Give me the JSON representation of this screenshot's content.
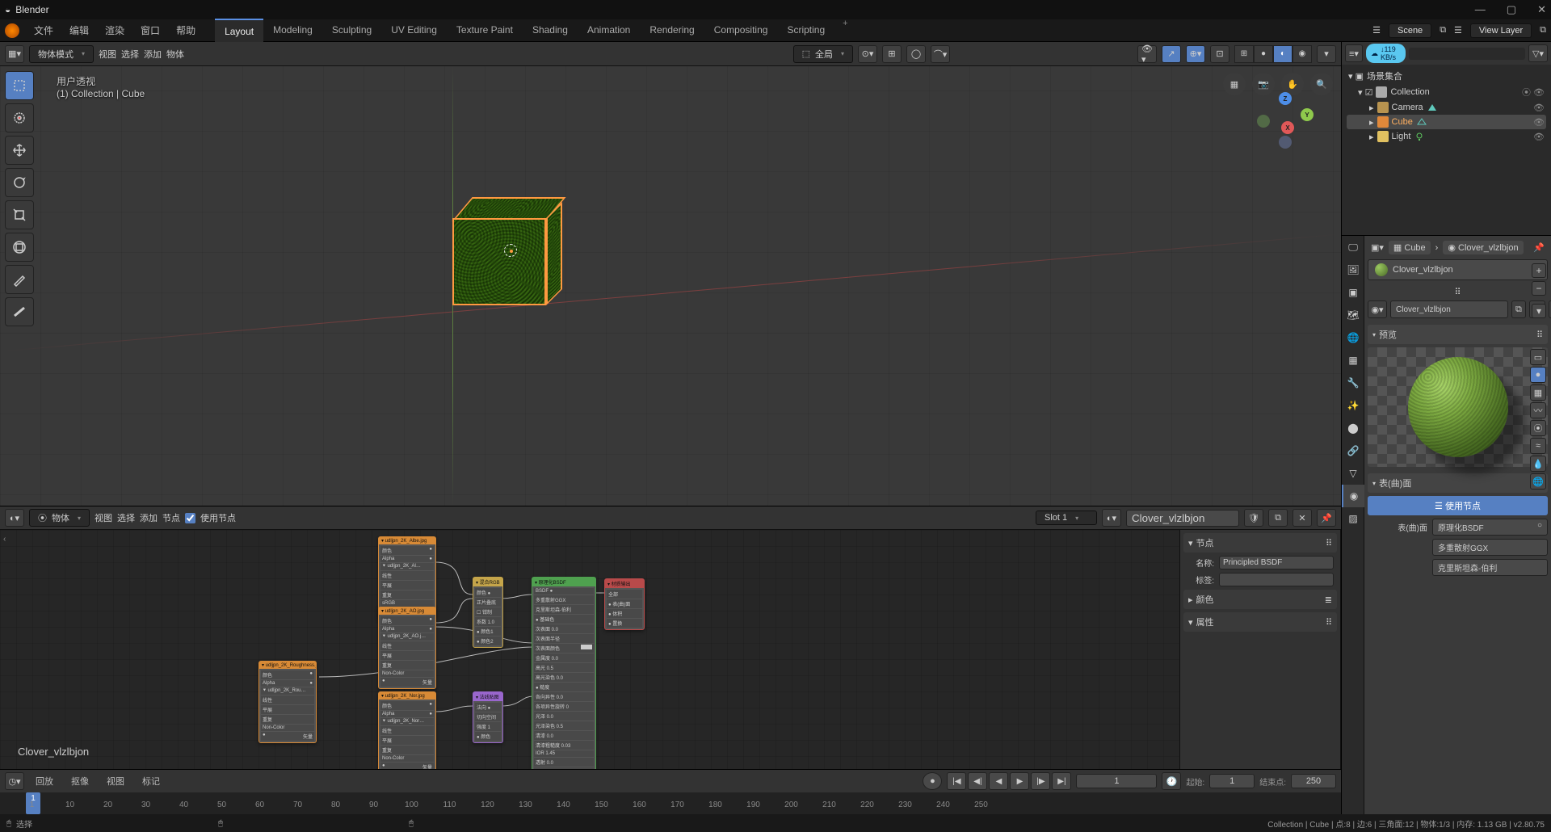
{
  "app": {
    "name": "Blender"
  },
  "topmenu": [
    "文件",
    "编辑",
    "渲染",
    "窗口",
    "帮助"
  ],
  "workspaces": [
    "Layout",
    "Modeling",
    "Sculpting",
    "UV Editing",
    "Texture Paint",
    "Shading",
    "Animation",
    "Rendering",
    "Compositing",
    "Scripting"
  ],
  "active_workspace": "Layout",
  "scene": {
    "label": "Scene",
    "viewlayer": "View Layer"
  },
  "download_badge": "↓119 KB/s",
  "viewport": {
    "mode": "物体模式",
    "menus": [
      "视图",
      "选择",
      "添加",
      "物体"
    ],
    "snapping": "全局",
    "info_line1": "用户透视",
    "info_line2": "(1) Collection | Cube",
    "gizmo": {
      "x": "X",
      "y": "Y",
      "z": "Z"
    }
  },
  "outliner": {
    "root": "场景集合",
    "collection": "Collection",
    "items": [
      {
        "name": "Camera"
      },
      {
        "name": "Cube"
      },
      {
        "name": "Light"
      }
    ],
    "filter_placeholder": ""
  },
  "node_editor": {
    "mode_label": "物体",
    "menus": [
      "视图",
      "选择",
      "添加",
      "节点"
    ],
    "use_nodes": "使用节点",
    "slot": "Slot 1",
    "material": "Clover_vlzlbjon",
    "bottom_label": "Clover_vlzlbjon",
    "side": {
      "hdr_node": "节点",
      "hdr_props": "属性",
      "hdr_color": "颜色",
      "name_label": "名称:",
      "name_value": "Principled BSDF",
      "tag_label": "标签:"
    }
  },
  "properties": {
    "object": "Cube",
    "material": "Clover_vlzlbjon",
    "material_name_field": "Clover_vlzlbjon",
    "preview_hdr": "预览",
    "surface_hdr": "表(曲)面",
    "use_nodes_btn": "使用节点",
    "surface_label": "表(曲)面",
    "surface_val": "原理化BSDF",
    "distr": "多重散射GGX",
    "subsurf": "克里斯坦森-伯利"
  },
  "timeline": {
    "menus": [
      "回放",
      "抠像",
      "视图",
      "标记"
    ],
    "current": "1",
    "start_label": "起始:",
    "start": "1",
    "end_label": "结束点:",
    "end": "250",
    "ticks": [
      "1",
      "10",
      "20",
      "30",
      "40",
      "50",
      "60",
      "70",
      "80",
      "90",
      "100",
      "110",
      "120",
      "130",
      "140",
      "150",
      "160",
      "170",
      "180",
      "190",
      "200",
      "210",
      "220",
      "230",
      "240",
      "250"
    ]
  },
  "status": {
    "left": "选择",
    "right": "Collection | Cube | 点:8 | 边:6 | 三角面:12 | 物体:1/3 | 内存: 1.13 GB | v2.80.75"
  }
}
